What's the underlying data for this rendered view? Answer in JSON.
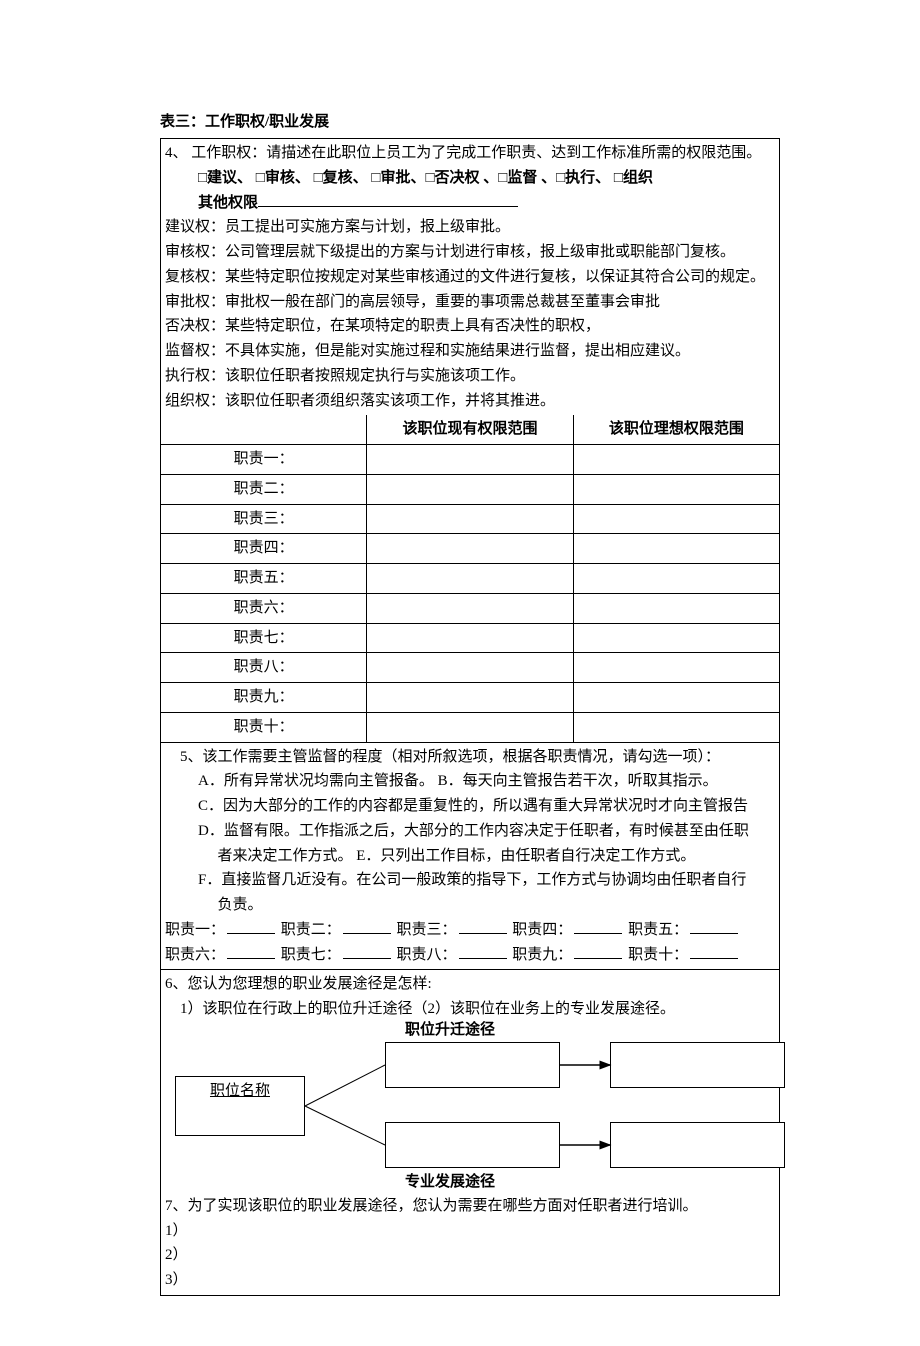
{
  "title": "表三：工作职权/职业发展",
  "section4": {
    "heading": "4、 工作职权：请描述在此职位上员工为了完成工作职责、达到工作标准所需的权限范围。",
    "checkboxes": "□建议、  □审核、  □复核、  □审批、□否决权 、□监督 、□执行、  □组织",
    "other_perm_label": "其他权限",
    "defs": [
      "建议权：员工提出可实施方案与计划，报上级审批。",
      "审核权：公司管理层就下级提出的方案与计划进行审核，报上级审批或职能部门复核。",
      "复核权：某些特定职位按规定对某些审核通过的文件进行复核，以保证其符合公司的规定。",
      "审批权：审批权一般在部门的高层领导，重要的事项需总裁甚至董事会审批",
      "否决权：某些特定职位，在某项特定的职责上具有否决性的职权，",
      "监督权：不具体实施，但是能对实施过程和实施结果进行监督，提出相应建议。",
      "执行权：该职位任职者按照规定执行与实施该项工作。",
      "组织权：该职位任职者须组织落实该项工作，并将其推进。"
    ],
    "tbl_head_current": "该职位现有权限范围",
    "tbl_head_ideal": "该职位理想权限范围",
    "rows": [
      "职责一：",
      "职责二：",
      "职责三：",
      "职责四：",
      "职责五：",
      "职责六：",
      "职责七：",
      "职责八：",
      "职责九：",
      "职责十："
    ]
  },
  "section5": {
    "heading": "5、该工作需要主管监督的程度（相对所叙选项，根据各职责情况，请勾选一项）：",
    "opts": [
      "A．所有异常状况均需向主管报备。    B．每天向主管报告若干次，听取其指示。",
      "C．因为大部分的工作的内容都是重复性的，所以遇有重大异常状况时才向主管报告",
      "D．监督有限。工作指派之后，大部分的工作内容决定于任职者，有时候甚至由任职",
      "者来决定工作方式。          E．只列出工作目标，由任职者自行决定工作方式。",
      "F．直接监督几近没有。在公司一般政策的指导下，工作方式与协调均由任职者自行",
      "负责。"
    ],
    "duty_labels_1": [
      "职责一：",
      "职责二：",
      "职责三：",
      "职责四：",
      "职责五："
    ],
    "duty_labels_2": [
      "职责六：",
      "职责七：",
      "职责八：",
      "职责九：",
      "职责十："
    ]
  },
  "section6": {
    "heading": "6、您认为您理想的职业发展途径是怎样:",
    "sub": "1）该职位在行政上的职位升迁途径（2）该职位在业务上的专业发展途径。",
    "diagram": {
      "start": "职位名称",
      "top_label": "职位升迁途径",
      "bot_label": "专业发展途径"
    }
  },
  "section7": {
    "heading": "7、为了实现该职位的职业发展途径，您认为需要在哪些方面对任职者进行培训。",
    "items": [
      "1）",
      "2）",
      "3）"
    ]
  }
}
